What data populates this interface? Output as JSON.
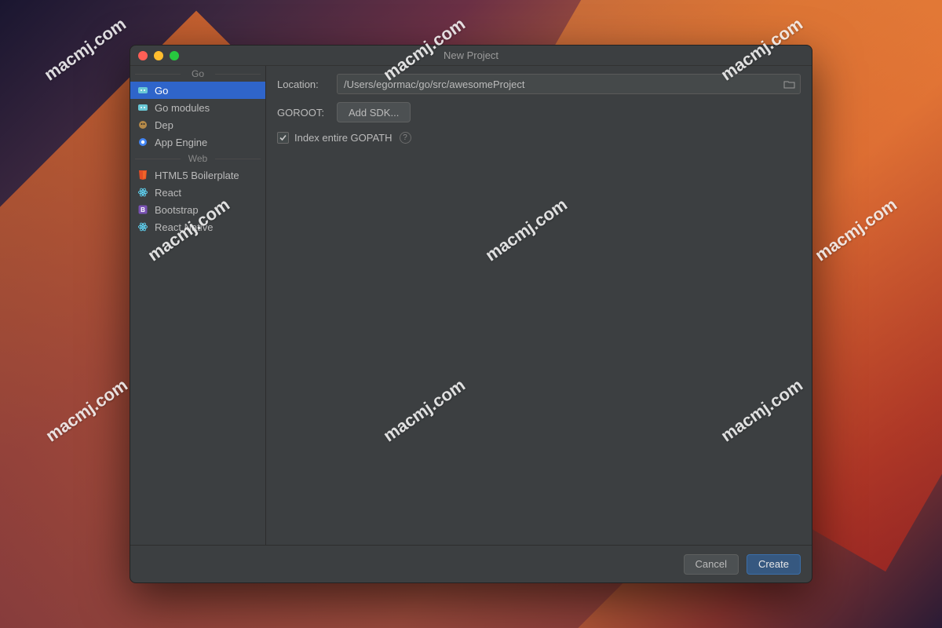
{
  "dialog": {
    "title": "New Project"
  },
  "sidebar": {
    "sections": [
      {
        "header": "Go",
        "items": [
          {
            "label": "Go",
            "icon": "go-icon",
            "selected": true
          },
          {
            "label": "Go modules",
            "icon": "go-icon",
            "selected": false
          },
          {
            "label": "Dep",
            "icon": "dep-icon",
            "selected": false
          },
          {
            "label": "App Engine",
            "icon": "appengine-icon",
            "selected": false
          }
        ]
      },
      {
        "header": "Web",
        "items": [
          {
            "label": "HTML5 Boilerplate",
            "icon": "html5-icon",
            "selected": false
          },
          {
            "label": "React",
            "icon": "react-icon",
            "selected": false
          },
          {
            "label": "Bootstrap",
            "icon": "bootstrap-icon",
            "selected": false
          },
          {
            "label": "React Native",
            "icon": "react-icon",
            "selected": false
          }
        ]
      }
    ]
  },
  "form": {
    "location_label": "Location:",
    "location_value": "/Users/egormac/go/src/awesomeProject",
    "goroot_label": "GOROOT:",
    "add_sdk_label": "Add SDK...",
    "index_gopath_label": "Index entire GOPATH",
    "index_gopath_checked": true
  },
  "footer": {
    "cancel": "Cancel",
    "create": "Create"
  },
  "watermark": "macmj.com"
}
